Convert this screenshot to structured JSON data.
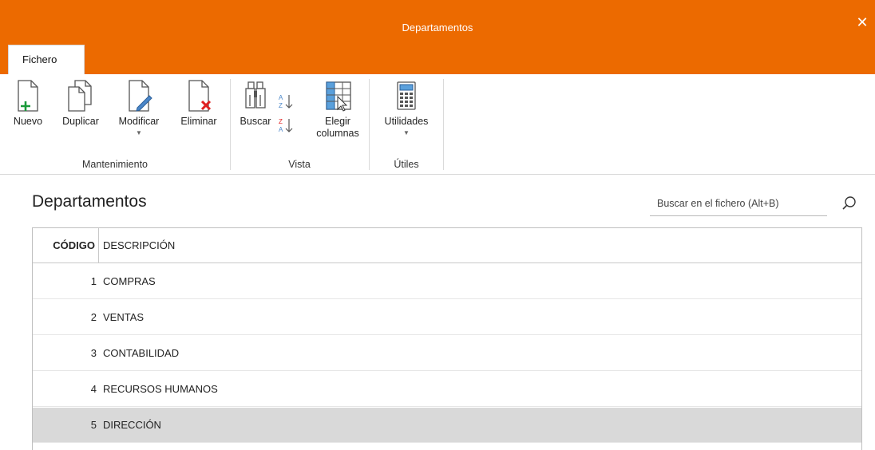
{
  "window": {
    "title": "Departamentos",
    "close_glyph": "✕",
    "accent_color": "#ec6a00"
  },
  "ribbon": {
    "tab_label": "Fichero",
    "groups": {
      "mantenimiento": {
        "label": "Mantenimiento",
        "buttons": {
          "nuevo": {
            "label": "Nuevo",
            "icon": "new-document-icon"
          },
          "duplicar": {
            "label": "Duplicar",
            "icon": "duplicate-document-icon"
          },
          "modificar": {
            "label": "Modificar",
            "icon": "edit-document-icon"
          },
          "eliminar": {
            "label": "Eliminar",
            "icon": "delete-document-icon"
          }
        }
      },
      "vista": {
        "label": "Vista",
        "buttons": {
          "buscar": {
            "label": "Buscar",
            "icon": "binoculars-icon"
          },
          "elegir_columnas_line1": "Elegir",
          "elegir_columnas_line2": "columnas",
          "sort_asc_icon": "sort-az-icon",
          "sort_desc_icon": "sort-za-icon"
        }
      },
      "utiles": {
        "label": "Útiles",
        "buttons": {
          "utilidades": {
            "label": "Utilidades",
            "icon": "calculator-icon"
          }
        }
      }
    }
  },
  "main": {
    "title": "Departamentos",
    "search": {
      "placeholder": "Buscar en el fichero (Alt+B)",
      "value": ""
    }
  },
  "table": {
    "columns": {
      "code": "CÓDIGO",
      "description": "DESCRIPCIÓN"
    },
    "rows": [
      {
        "code": "1",
        "description": "COMPRAS"
      },
      {
        "code": "2",
        "description": "VENTAS"
      },
      {
        "code": "3",
        "description": "CONTABILIDAD"
      },
      {
        "code": "4",
        "description": "RECURSOS HUMANOS"
      },
      {
        "code": "5",
        "description": "DIRECCIÓN"
      }
    ],
    "selected_row": "5"
  }
}
